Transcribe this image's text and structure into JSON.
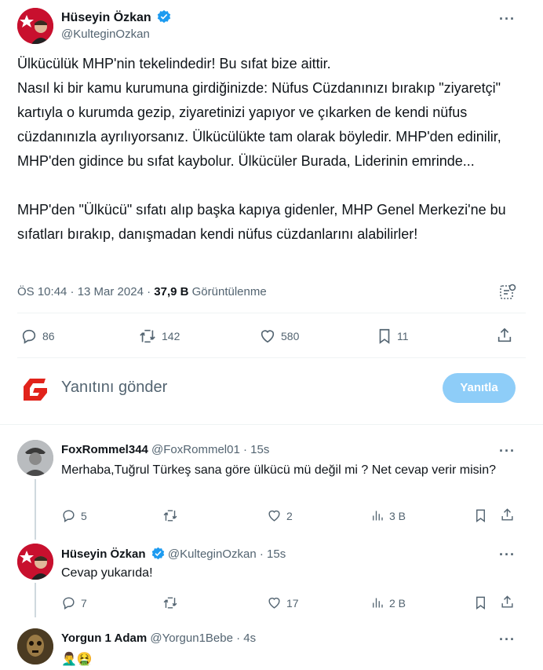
{
  "tweet": {
    "author_name": "Hüseyin Özkan",
    "author_handle": "@KulteginOzkan",
    "more": "···",
    "text": "Ülkücülük MHP'nin tekelindedir! Bu sıfat bize aittir.\nNasıl ki bir kamu kurumuna girdiğinizde: Nüfus Cüzdanınızı bırakıp \"ziyaretçi\" kartıyla o kurumda gezip, ziyaretinizi yapıyor ve çıkarken de kendi nüfus cüzdanınızla ayrılıyorsanız. Ülkücülükte tam olarak böyledir. MHP'den edinilir, MHP'den gidince bu sıfat kaybolur. Ülkücüler Burada, Liderinin emrinde...\n\nMHP'den \"Ülkücü\" sıfatı alıp başka kapıya gidenler, MHP Genel Merkezi'ne bu sıfatları bırakıp, danışmadan kendi nüfus cüzdanlarını alabilirler!",
    "timestamp": "ÖS 10:44 · 13 Mar 2024 ·",
    "views_count": "37,9 B",
    "views_label": "Görüntülenme",
    "replies": "86",
    "retweets": "142",
    "likes": "580",
    "bookmarks": "11"
  },
  "composer": {
    "placeholder": "Yanıtını gönder",
    "button_label": "Yanıtla",
    "logo_letter": "G"
  },
  "replies": [
    {
      "name": "FoxRommel344",
      "handle": "@FoxRommel01",
      "time": "· 15s",
      "text": "Merhaba,Tuğrul Türkeş sana göre ülkücü mü değil mi ? Net cevap verir misin?",
      "replies": "5",
      "retweets": "",
      "likes": "2",
      "views": "3 B"
    },
    {
      "name": "Hüseyin Özkan",
      "handle": "@KulteginOzkan",
      "time": "· 15s",
      "text": "Cevap yukarıda!",
      "replies": "7",
      "retweets": "",
      "likes": "17",
      "views": "2 B"
    },
    {
      "name": "Yorgun 1 Adam",
      "handle": "@Yorgun1Bebe",
      "time": "· 4s",
      "text": "🤦‍♂️🤮"
    }
  ],
  "colors": {
    "accent": "#1d9bf0",
    "reply_button_disabled": "#8ecdf8",
    "logo_red": "#e1231b"
  }
}
